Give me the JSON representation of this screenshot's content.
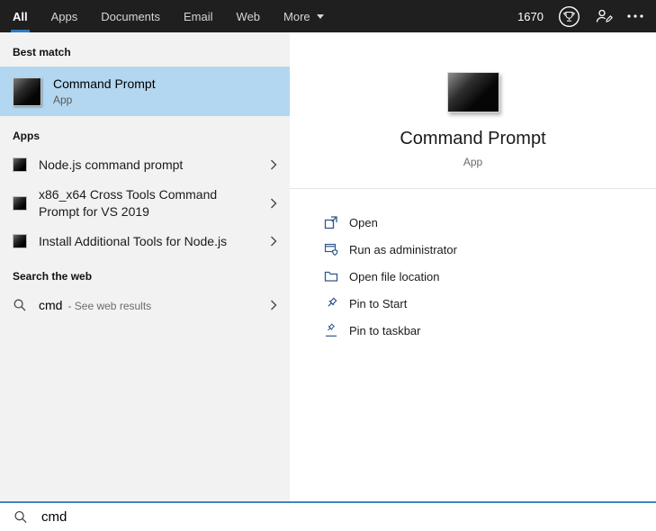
{
  "topbar": {
    "tabs": [
      {
        "label": "All"
      },
      {
        "label": "Apps"
      },
      {
        "label": "Documents"
      },
      {
        "label": "Email"
      },
      {
        "label": "Web"
      },
      {
        "label": "More"
      }
    ],
    "points": "1670"
  },
  "left": {
    "best_match_header": "Best match",
    "best_match": {
      "title": "Command Prompt",
      "subtitle": "App"
    },
    "apps_header": "Apps",
    "apps": [
      {
        "label": "Node.js command prompt"
      },
      {
        "label": "x86_x64 Cross Tools Command Prompt for VS 2019"
      },
      {
        "label": "Install Additional Tools for Node.js"
      }
    ],
    "web_header": "Search the web",
    "web": {
      "query": "cmd",
      "suffix": "- See web results"
    }
  },
  "right": {
    "title": "Command Prompt",
    "subtitle": "App",
    "actions": [
      {
        "label": "Open"
      },
      {
        "label": "Run as administrator"
      },
      {
        "label": "Open file location"
      },
      {
        "label": "Pin to Start"
      },
      {
        "label": "Pin to taskbar"
      }
    ]
  },
  "searchbar": {
    "value": "cmd"
  },
  "colors": {
    "accent": "#2f7cc0",
    "selection_highlight": "#b3d7f0",
    "topbar_background": "#1f1f1f"
  }
}
